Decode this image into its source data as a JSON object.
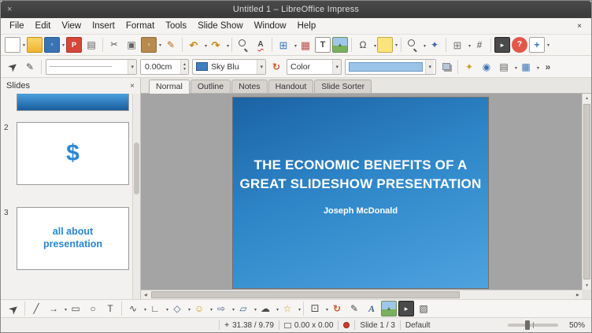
{
  "window": {
    "title": "Untitled 1 – LibreOffice Impress"
  },
  "icons": {
    "close": "×"
  },
  "menubar": {
    "items": [
      "File",
      "Edit",
      "View",
      "Insert",
      "Format",
      "Tools",
      "Slide Show",
      "Window",
      "Help"
    ]
  },
  "toolbar_main": {
    "icons": [
      {
        "name": "new-document",
        "glyph": ""
      },
      {
        "name": "open-folder",
        "glyph": ""
      },
      {
        "name": "save",
        "glyph": "▫"
      },
      {
        "name": "export-pdf",
        "glyph": "P"
      },
      {
        "name": "print",
        "glyph": "▤"
      },
      {
        "name": "cut",
        "glyph": "✂"
      },
      {
        "name": "copy",
        "glyph": "▣"
      },
      {
        "name": "paste",
        "glyph": "▫"
      },
      {
        "name": "clone-formatting",
        "glyph": "✎"
      },
      {
        "name": "undo",
        "glyph": "↶"
      },
      {
        "name": "redo",
        "glyph": "↷"
      },
      {
        "name": "find-replace",
        "glyph": ""
      },
      {
        "name": "spelling",
        "glyph": "A"
      },
      {
        "name": "table",
        "glyph": "⊞"
      },
      {
        "name": "chart",
        "glyph": "▦"
      },
      {
        "name": "text-box",
        "glyph": "T"
      },
      {
        "name": "insert-image",
        "glyph": "▲"
      },
      {
        "name": "special-character",
        "glyph": "Ω"
      },
      {
        "name": "insert-comment",
        "glyph": ""
      },
      {
        "name": "zoom",
        "glyph": ""
      },
      {
        "name": "navigator",
        "glyph": "✦"
      },
      {
        "name": "display-grid",
        "glyph": "⊞"
      },
      {
        "name": "snap-lines",
        "glyph": "#"
      },
      {
        "name": "start-slideshow",
        "glyph": "▸"
      },
      {
        "name": "help",
        "glyph": "?"
      },
      {
        "name": "new-slide",
        "glyph": "+"
      }
    ]
  },
  "toolbar_line": {
    "line_width": "0.00cm",
    "line_color": "Sky Blu",
    "area_style": "Color",
    "icons": [
      {
        "name": "select2",
        "glyph": "➤"
      },
      {
        "name": "edit-points2",
        "glyph": "✎"
      },
      {
        "name": "rotate",
        "glyph": "↻"
      },
      {
        "name": "shadow",
        "glyph": ""
      },
      {
        "name": "animation-effects",
        "glyph": "✦"
      },
      {
        "name": "interaction",
        "glyph": "◉"
      },
      {
        "name": "master-slide",
        "glyph": "▤"
      },
      {
        "name": "display-views",
        "glyph": "▦"
      },
      {
        "name": "toolbar-more",
        "glyph": "»"
      }
    ]
  },
  "slides_panel": {
    "title": "Slides",
    "slides": [
      {
        "number": "",
        "text": ""
      },
      {
        "number": "2",
        "text": "$"
      },
      {
        "number": "3",
        "text": "all about presentation"
      }
    ]
  },
  "view_tabs": {
    "tabs": [
      "Normal",
      "Outline",
      "Notes",
      "Handout",
      "Slide Sorter"
    ],
    "active": "Normal"
  },
  "slide": {
    "title_line1": "THE ECONOMIC BENEFITS OF A",
    "title_line2": "GREAT SLIDESHOW PRESENTATION",
    "subtitle": "Joseph McDonald"
  },
  "drawing_toolbar": {
    "icons": [
      {
        "name": "select",
        "glyph": "➤"
      },
      {
        "name": "line",
        "glyph": "╱"
      },
      {
        "name": "arrow",
        "glyph": "→"
      },
      {
        "name": "rectangle",
        "glyph": "▭"
      },
      {
        "name": "ellipse",
        "glyph": "○"
      },
      {
        "name": "text",
        "glyph": "T"
      },
      {
        "name": "curve",
        "glyph": "∿"
      },
      {
        "name": "connector",
        "glyph": "∟"
      },
      {
        "name": "basic-shapes",
        "glyph": "◇"
      },
      {
        "name": "symbol-shapes",
        "glyph": "☺"
      },
      {
        "name": "block-arrows",
        "glyph": "⇨"
      },
      {
        "name": "flowchart",
        "glyph": "▱"
      },
      {
        "name": "callouts",
        "glyph": "☁"
      },
      {
        "name": "stars",
        "glyph": "☆"
      },
      {
        "name": "3d-objects",
        "glyph": "⚀"
      },
      {
        "name": "rotate2",
        "glyph": "↻"
      },
      {
        "name": "edit-points",
        "glyph": "✎"
      },
      {
        "name": "fontwork",
        "glyph": "A"
      },
      {
        "name": "insert-image2",
        "glyph": "▲"
      },
      {
        "name": "insert-media",
        "glyph": "▸"
      },
      {
        "name": "extrusion",
        "glyph": "▧"
      }
    ]
  },
  "statusbar": {
    "position": "31.38 / 9.79",
    "size": "0.00 x 0.00",
    "slide": "Slide 1 / 3",
    "style": "Default",
    "zoom": "50%"
  },
  "colors": {
    "slide_gradient_start": "#1b62a4",
    "slide_gradient_end": "#4ea3de",
    "accent_blue": "#2a86d0",
    "line_color_swatch": "#3e7fc1"
  }
}
